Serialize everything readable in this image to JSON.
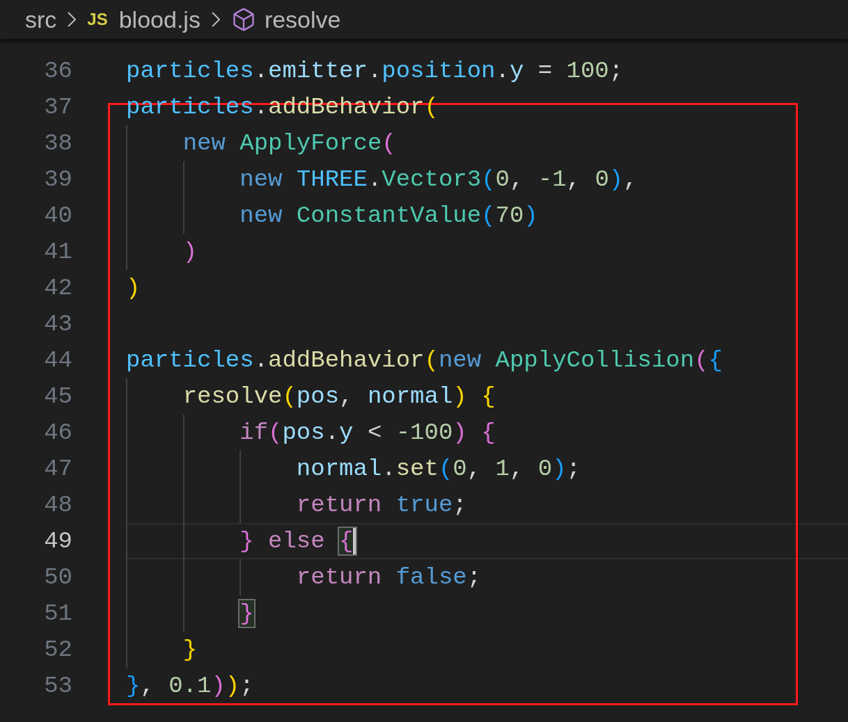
{
  "breadcrumb": [
    {
      "kind": "folder",
      "label": "src"
    },
    {
      "kind": "file",
      "badge": "JS",
      "label": "blood.js"
    },
    {
      "kind": "symbol",
      "label": "resolve"
    }
  ],
  "editor": {
    "lines": [
      {
        "number": "36",
        "current": false,
        "tokens": [
          {
            "text": "particles",
            "color": "#4fc1ff"
          },
          {
            "text": ".",
            "color": "#d4d4d4"
          },
          {
            "text": "emitter",
            "color": "#9cdcfe"
          },
          {
            "text": ".",
            "color": "#d4d4d4"
          },
          {
            "text": "position",
            "color": "#4fc1ff"
          },
          {
            "text": ".",
            "color": "#d4d4d4"
          },
          {
            "text": "y",
            "color": "#9cdcfe"
          },
          {
            "text": " = ",
            "color": "#d4d4d4"
          },
          {
            "text": "100",
            "color": "#b5cea8"
          },
          {
            "text": ";",
            "color": "#d4d4d4"
          }
        ]
      },
      {
        "number": "37",
        "current": false,
        "tokens": [
          {
            "text": "particles",
            "color": "#4fc1ff"
          },
          {
            "text": ".",
            "color": "#d4d4d4"
          },
          {
            "text": "addBehavior",
            "color": "#dcdcaa"
          },
          {
            "text": "(",
            "color": "#ffd700"
          }
        ]
      },
      {
        "number": "38",
        "current": false,
        "tokens": [
          {
            "text": "    new ",
            "color": "#569cd6"
          },
          {
            "text": "ApplyForce",
            "color": "#4ec9b0"
          },
          {
            "text": "(",
            "color": "#da70d6"
          }
        ]
      },
      {
        "number": "39",
        "current": false,
        "tokens": [
          {
            "text": "        new ",
            "color": "#569cd6"
          },
          {
            "text": "THREE",
            "color": "#4fc1ff"
          },
          {
            "text": ".",
            "color": "#d4d4d4"
          },
          {
            "text": "Vector3",
            "color": "#4ec9b0"
          },
          {
            "text": "(",
            "color": "#179fff"
          },
          {
            "text": "0",
            "color": "#b5cea8"
          },
          {
            "text": ", ",
            "color": "#d4d4d4"
          },
          {
            "text": "-1",
            "color": "#b5cea8"
          },
          {
            "text": ", ",
            "color": "#d4d4d4"
          },
          {
            "text": "0",
            "color": "#b5cea8"
          },
          {
            "text": ")",
            "color": "#179fff"
          },
          {
            "text": ",",
            "color": "#d4d4d4"
          }
        ]
      },
      {
        "number": "40",
        "current": false,
        "tokens": [
          {
            "text": "        new ",
            "color": "#569cd6"
          },
          {
            "text": "ConstantValue",
            "color": "#4ec9b0"
          },
          {
            "text": "(",
            "color": "#179fff"
          },
          {
            "text": "70",
            "color": "#b5cea8"
          },
          {
            "text": ")",
            "color": "#179fff"
          }
        ]
      },
      {
        "number": "41",
        "current": false,
        "tokens": [
          {
            "text": "    )",
            "color": "#da70d6"
          }
        ]
      },
      {
        "number": "42",
        "current": false,
        "tokens": [
          {
            "text": ")",
            "color": "#ffd700"
          }
        ]
      },
      {
        "number": "43",
        "current": false
      },
      {
        "number": "44",
        "current": false,
        "tokens": [
          {
            "text": "particles",
            "color": "#4fc1ff"
          },
          {
            "text": ".",
            "color": "#d4d4d4"
          },
          {
            "text": "addBehavior",
            "color": "#dcdcaa"
          },
          {
            "text": "(",
            "color": "#ffd700"
          },
          {
            "text": "new ",
            "color": "#569cd6"
          },
          {
            "text": "ApplyCollision",
            "color": "#4ec9b0"
          },
          {
            "text": "(",
            "color": "#da70d6"
          },
          {
            "text": "{",
            "color": "#179fff"
          }
        ]
      },
      {
        "number": "45",
        "current": false,
        "tokens": [
          {
            "text": "    resolve",
            "color": "#dcdcaa"
          },
          {
            "text": "(",
            "color": "#ffd700"
          },
          {
            "text": "pos",
            "color": "#9cdcfe"
          },
          {
            "text": ", ",
            "color": "#d4d4d4"
          },
          {
            "text": "normal",
            "color": "#9cdcfe"
          },
          {
            "text": ")",
            "color": "#ffd700"
          },
          {
            "text": " {",
            "color": "#ffd700"
          }
        ]
      },
      {
        "number": "46",
        "current": false,
        "tokens": [
          {
            "text": "        if",
            "color": "#c586c0"
          },
          {
            "text": "(",
            "color": "#da70d6"
          },
          {
            "text": "pos",
            "color": "#9cdcfe"
          },
          {
            "text": ".",
            "color": "#d4d4d4"
          },
          {
            "text": "y",
            "color": "#9cdcfe"
          },
          {
            "text": " < ",
            "color": "#d4d4d4"
          },
          {
            "text": "-100",
            "color": "#b5cea8"
          },
          {
            "text": ")",
            "color": "#da70d6"
          },
          {
            "text": " {",
            "color": "#da70d6"
          }
        ]
      },
      {
        "number": "47",
        "current": false,
        "tokens": [
          {
            "text": "            normal",
            "color": "#9cdcfe"
          },
          {
            "text": ".",
            "color": "#d4d4d4"
          },
          {
            "text": "set",
            "color": "#dcdcaa"
          },
          {
            "text": "(",
            "color": "#179fff"
          },
          {
            "text": "0",
            "color": "#b5cea8"
          },
          {
            "text": ", ",
            "color": "#d4d4d4"
          },
          {
            "text": "1",
            "color": "#b5cea8"
          },
          {
            "text": ", ",
            "color": "#d4d4d4"
          },
          {
            "text": "0",
            "color": "#b5cea8"
          },
          {
            "text": ")",
            "color": "#179fff"
          },
          {
            "text": ";",
            "color": "#d4d4d4"
          }
        ]
      },
      {
        "number": "48",
        "current": false,
        "tokens": [
          {
            "text": "            return ",
            "color": "#c586c0"
          },
          {
            "text": "true",
            "color": "#569cd6"
          },
          {
            "text": ";",
            "color": "#d4d4d4"
          }
        ]
      },
      {
        "number": "49",
        "current": true,
        "tokens": [
          {
            "text": "        }",
            "color": "#da70d6"
          },
          {
            "text": " else ",
            "color": "#c586c0"
          },
          {
            "text": "{",
            "color": "#da70d6",
            "matched": true,
            "cursor": true
          }
        ]
      },
      {
        "number": "50",
        "current": false,
        "tokens": [
          {
            "text": "            return ",
            "color": "#c586c0"
          },
          {
            "text": "false",
            "color": "#569cd6"
          },
          {
            "text": ";",
            "color": "#d4d4d4"
          }
        ]
      },
      {
        "number": "51",
        "current": false,
        "tokens": [
          {
            "text": "        }",
            "color": "#da70d6",
            "matched": true
          }
        ]
      },
      {
        "number": "52",
        "current": false,
        "tokens": [
          {
            "text": "    }",
            "color": "#ffd700"
          }
        ]
      },
      {
        "number": "53",
        "current": false,
        "tokens": [
          {
            "text": "}",
            "color": "#179fff"
          },
          {
            "text": ", ",
            "color": "#d4d4d4"
          },
          {
            "text": "0.1",
            "color": "#b5cea8"
          },
          {
            "text": ")",
            "color": "#da70d6"
          },
          {
            "text": ")",
            "color": "#ffd700"
          },
          {
            "text": ";",
            "color": "#d4d4d4"
          }
        ]
      }
    ]
  }
}
